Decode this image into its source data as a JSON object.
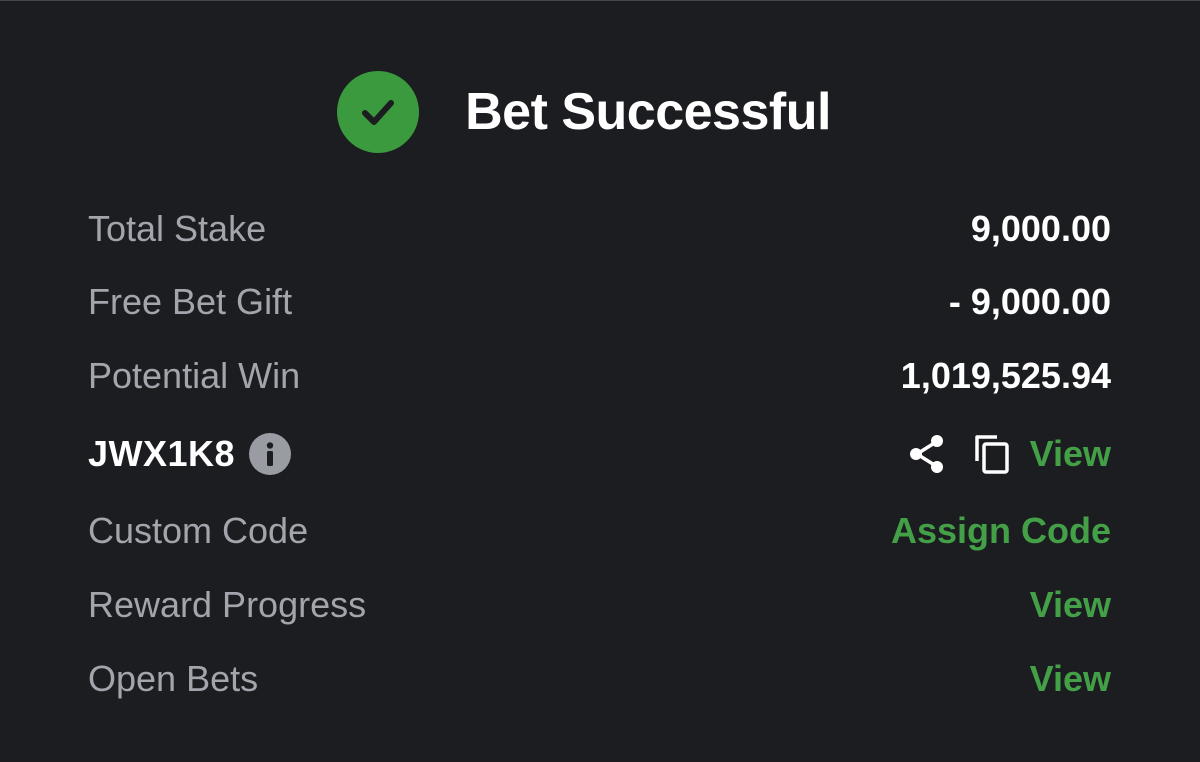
{
  "header": {
    "title": "Bet Successful",
    "icon": "check-circle-icon",
    "icon_color": "#3a9a3d"
  },
  "rows": {
    "total_stake": {
      "label": "Total Stake",
      "value": "9,000.00"
    },
    "free_bet_gift": {
      "label": "Free Bet Gift",
      "value": "- 9,000.00"
    },
    "potential_win": {
      "label": "Potential Win",
      "value": "1,019,525.94"
    },
    "booking": {
      "code": "JWX1K8",
      "info_icon": "info-icon",
      "share_icon": "share-icon",
      "copy_icon": "copy-icon",
      "view_label": "View"
    },
    "custom_code": {
      "label": "Custom Code",
      "action": "Assign Code"
    },
    "reward_progress": {
      "label": "Reward Progress",
      "action": "View"
    },
    "open_bets": {
      "label": "Open Bets",
      "action": "View"
    }
  },
  "colors": {
    "background": "#1c1d21",
    "accent_green": "#43a047",
    "label_gray": "#a3a5ad",
    "value_white": "#ffffff"
  }
}
